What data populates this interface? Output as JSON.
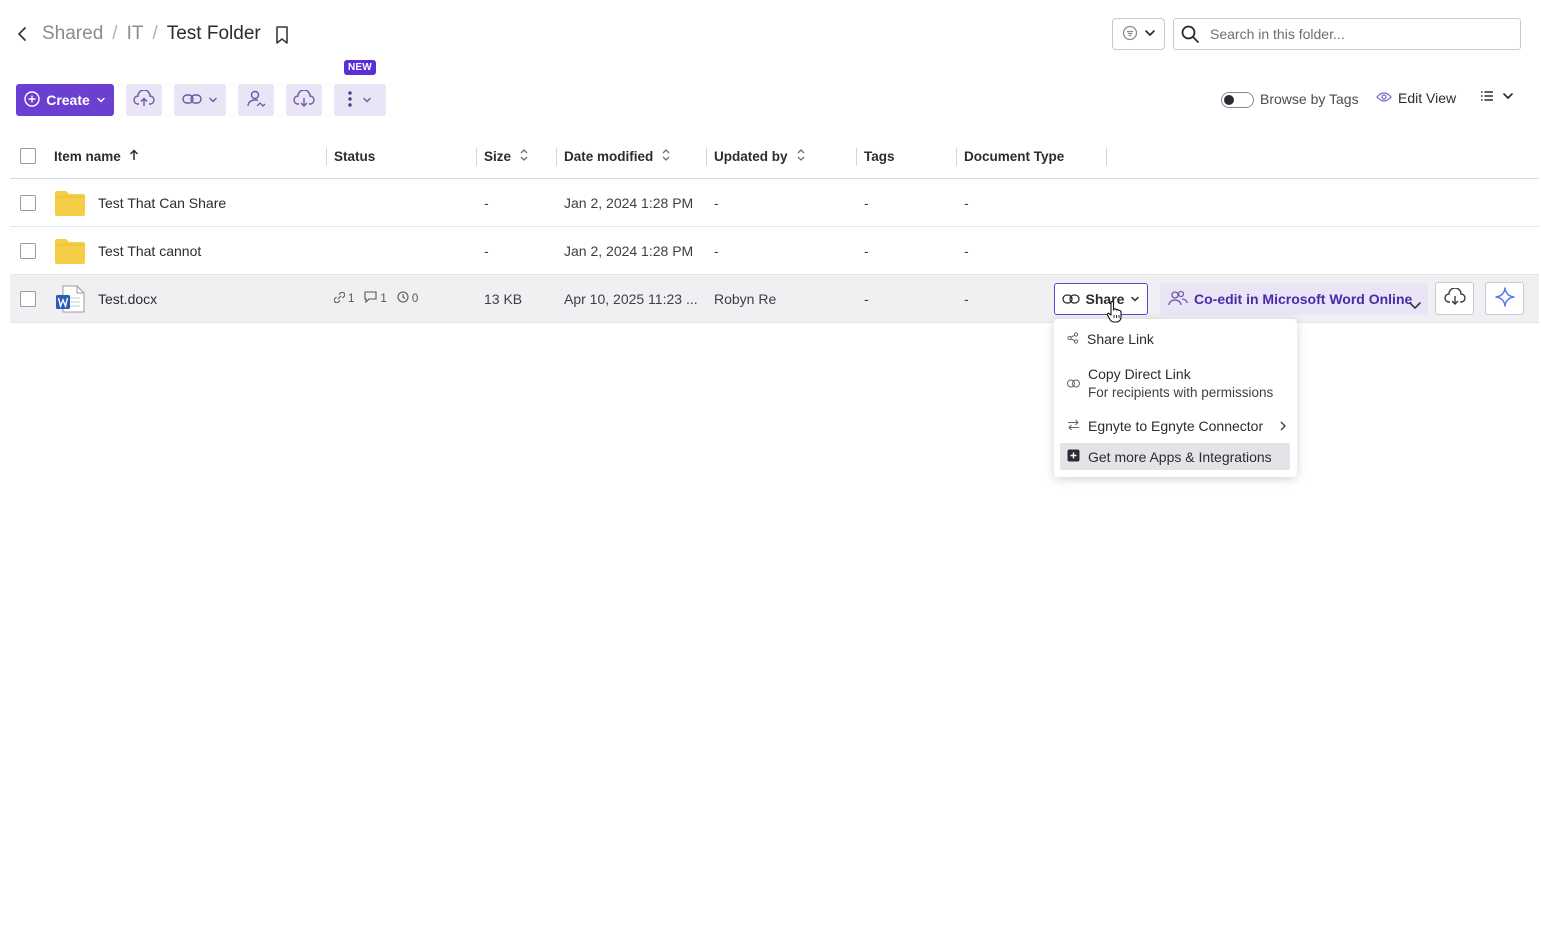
{
  "breadcrumb": {
    "items": [
      "Shared",
      "IT"
    ],
    "separator": "/",
    "current": "Test Folder"
  },
  "search": {
    "placeholder": "Search in this folder..."
  },
  "toolbar": {
    "create_label": "Create",
    "new_badge": "NEW"
  },
  "view": {
    "browse_by_tags": "Browse by Tags",
    "edit_view": "Edit View"
  },
  "table": {
    "headers": {
      "name": "Item name",
      "status": "Status",
      "size": "Size",
      "date": "Date modified",
      "updated_by": "Updated by",
      "tags": "Tags",
      "doc_type": "Document Type"
    },
    "rows": [
      {
        "name": "Test That Can Share",
        "type": "folder",
        "status": "",
        "size": "-",
        "date": "Jan 2, 2024 1:28 PM",
        "updated_by": "-",
        "tags": "-",
        "doc_type": "-"
      },
      {
        "name": "Test That cannot",
        "type": "folder",
        "status": "",
        "size": "-",
        "date": "Jan 2, 2024 1:28 PM",
        "updated_by": "-",
        "tags": "-",
        "doc_type": "-"
      },
      {
        "name": "Test.docx",
        "type": "word-file",
        "status": {
          "links": "1",
          "comments": "1",
          "versions": "0"
        },
        "size": "13 KB",
        "date": "Apr 10, 2025 11:23 ...",
        "updated_by": "Robyn Re",
        "tags": "-",
        "doc_type": "-"
      }
    ]
  },
  "row_actions": {
    "share": "Share",
    "coedit": "Co-edit in Microsoft Word Online"
  },
  "share_menu": {
    "share_link": "Share Link",
    "copy_direct_link": "Copy Direct Link",
    "copy_direct_link_sub": "For recipients with permissions",
    "connector": "Egnyte to Egnyte Connector",
    "more_apps": "Get more Apps & Integrations"
  },
  "colors": {
    "accent": "#6a3fd1",
    "accent_light": "#e9e5f6",
    "folder": "#f5cd47",
    "word": "#2b5cb8"
  }
}
